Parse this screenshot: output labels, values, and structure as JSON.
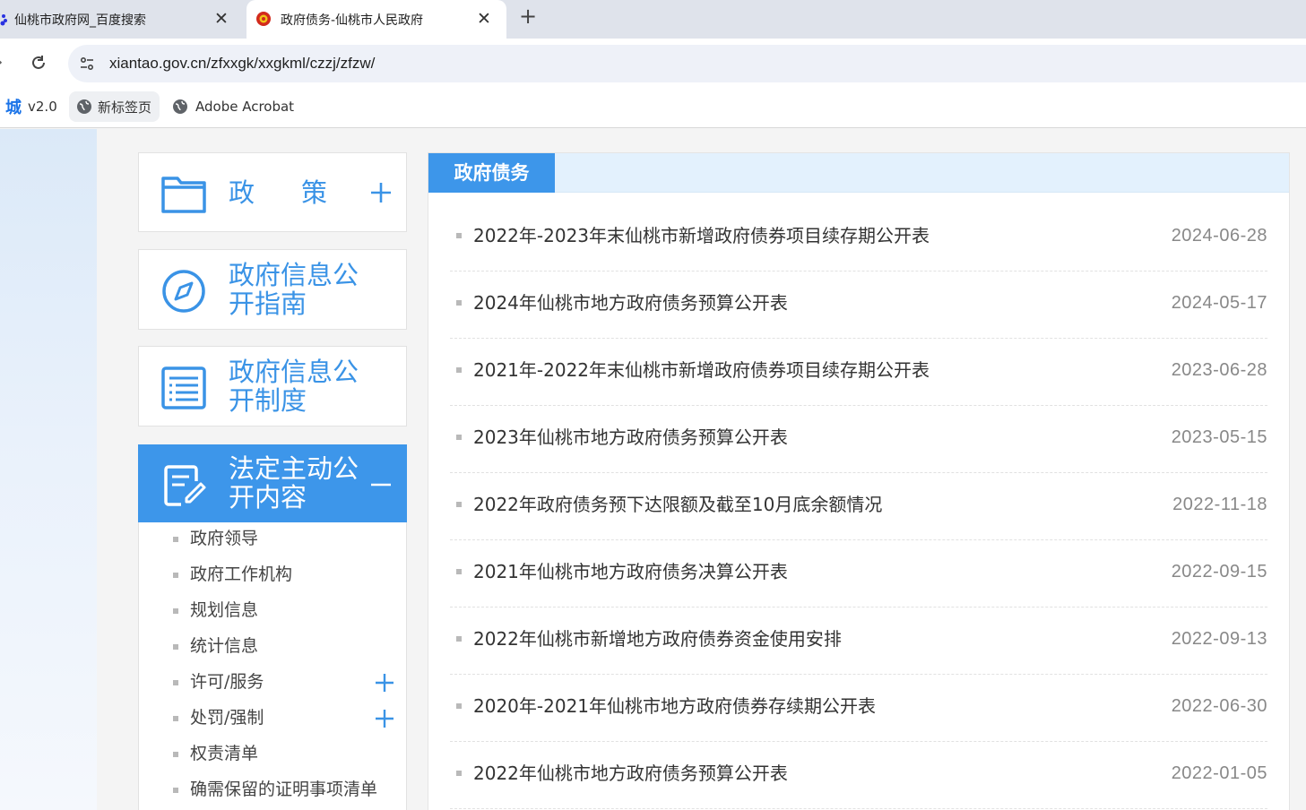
{
  "browser": {
    "tabs": [
      {
        "title": "仙桃市政府网_百度搜索",
        "active": false
      },
      {
        "title": "政府债务-仙桃市人民政府",
        "active": true
      }
    ],
    "url": "xiantao.gov.cn/zfxxgk/xxgkml/czzj/zfzw/",
    "bookmarks": [
      {
        "prefix": "城",
        "label": "v2.0"
      },
      {
        "label": "新标签页"
      },
      {
        "label": "Adobe Acrobat"
      }
    ]
  },
  "sidebar": {
    "boxes": [
      {
        "label": "政策",
        "icon": "folder-icon",
        "toggle": "plus"
      },
      {
        "label": "政府信息公开指南",
        "icon": "compass-icon"
      },
      {
        "label": "政府信息公开制度",
        "icon": "list-document-icon"
      },
      {
        "label": "法定主动公开内容",
        "icon": "edit-document-icon",
        "toggle": "minus",
        "active": true
      }
    ],
    "subitems": [
      {
        "label": "政府领导"
      },
      {
        "label": "政府工作机构"
      },
      {
        "label": "规划信息"
      },
      {
        "label": "统计信息"
      },
      {
        "label": "许可/服务",
        "expandable": true
      },
      {
        "label": "处罚/强制",
        "expandable": true
      },
      {
        "label": "权责清单"
      },
      {
        "label": "确需保留的证明事项清单"
      }
    ]
  },
  "main": {
    "title": "政府债务",
    "articles": [
      {
        "title": "2022年-2023年末仙桃市新增政府债券项目续存期公开表",
        "date": "2024-06-28"
      },
      {
        "title": "2024年仙桃市地方政府债务预算公开表",
        "date": "2024-05-17"
      },
      {
        "title": "2021年-2022年末仙桃市新增政府债券项目续存期公开表",
        "date": "2023-06-28"
      },
      {
        "title": "2023年仙桃市地方政府债务预算公开表",
        "date": "2023-05-15"
      },
      {
        "title": "2022年政府债务预下达限额及截至10月底余额情况",
        "date": "2022-11-18"
      },
      {
        "title": "2021年仙桃市地方政府债务决算公开表",
        "date": "2022-09-15"
      },
      {
        "title": "2022年仙桃市新增地方政府债券资金使用安排",
        "date": "2022-09-13"
      },
      {
        "title": "2020年-2021年仙桃市地方政府债券存续期公开表",
        "date": "2022-06-30"
      },
      {
        "title": "2022年仙桃市地方政府债务预算公开表",
        "date": "2022-01-05"
      }
    ]
  },
  "colors": {
    "accent": "#3d96ea",
    "header_band": "#e3f1fd",
    "date_text": "#888888"
  }
}
